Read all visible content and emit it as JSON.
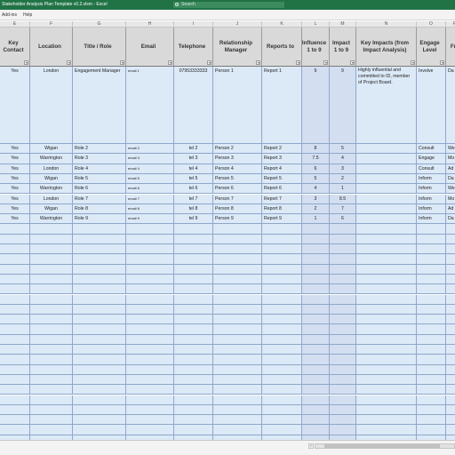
{
  "window": {
    "title": "Stakeholder Analysis Plan Template v0.2.xlsm  -  Excel",
    "search_placeholder": "Search"
  },
  "ribbon": {
    "tabs": [
      "Add-ins",
      "Help"
    ]
  },
  "columns": [
    {
      "letter": "E",
      "header": "Key\nContact",
      "key": "key_contact",
      "align": "c"
    },
    {
      "letter": "F",
      "header": "Location",
      "key": "location",
      "align": "c"
    },
    {
      "letter": "G",
      "header": "Title / Role",
      "key": "title",
      "align": "l"
    },
    {
      "letter": "H",
      "header": "Email",
      "key": "email",
      "align": "l",
      "tiny": true
    },
    {
      "letter": "I",
      "header": "Telephone",
      "key": "telephone",
      "align": "c"
    },
    {
      "letter": "J",
      "header": "Relationship\nManager",
      "key": "manager",
      "align": "l"
    },
    {
      "letter": "K",
      "header": "Reports to",
      "key": "reports_to",
      "align": "l"
    },
    {
      "letter": "L",
      "header": "Influence\n1 to 9",
      "key": "influence",
      "align": "c",
      "alt": true
    },
    {
      "letter": "M",
      "header": "Impact\n1 to 9",
      "key": "impact",
      "align": "c",
      "alt": true
    },
    {
      "letter": "N",
      "header": "Key Impacts (from\nImpact Analysis)",
      "key": "key_impacts",
      "align": "l"
    },
    {
      "letter": "O",
      "header": "Engage\nLevel",
      "key": "engage",
      "align": "l"
    },
    {
      "letter": "P",
      "header": "Fr",
      "key": "freq",
      "align": "l"
    }
  ],
  "rows": [
    {
      "key_contact": "Yes",
      "location": "London",
      "title": "Engagement Manager",
      "email": "email 1",
      "telephone": "07953333333",
      "manager": "Person 1",
      "reports_to": "Report 1",
      "influence": "9",
      "impact": "9",
      "key_impacts": "Highly influential and committed to ID, member of Project Board.",
      "engage": "Involve",
      "freq": "Da"
    },
    {
      "key_contact": "Yes",
      "location": "Wigan",
      "title": "Role 2",
      "email": "email 2",
      "telephone": "tel 2",
      "manager": "Person 2",
      "reports_to": "Report 2",
      "influence": "8",
      "impact": "5",
      "key_impacts": "",
      "engage": "Consult",
      "freq": "We"
    },
    {
      "key_contact": "Yes",
      "location": "Warrington",
      "title": "Role 3",
      "email": "email 3",
      "telephone": "tel 3",
      "manager": "Person 3",
      "reports_to": "Report 3",
      "influence": "7.5",
      "impact": "4",
      "key_impacts": "",
      "engage": "Engage",
      "freq": "Mo"
    },
    {
      "key_contact": "Yes",
      "location": "London",
      "title": "Role 4",
      "email": "email 4",
      "telephone": "tel 4",
      "manager": "Person 4",
      "reports_to": "Report 4",
      "influence": "6",
      "impact": "3",
      "key_impacts": "",
      "engage": "Consult",
      "freq": "Ad"
    },
    {
      "key_contact": "Yes",
      "location": "Wigan",
      "title": "Role 5",
      "email": "email 5",
      "telephone": "tel 5",
      "manager": "Person 5",
      "reports_to": "Report 5",
      "influence": "5",
      "impact": "2",
      "key_impacts": "",
      "engage": "Inform",
      "freq": "Da"
    },
    {
      "key_contact": "Yes",
      "location": "Warrington",
      "title": "Role 6",
      "email": "email 6",
      "telephone": "tel 6",
      "manager": "Person 6",
      "reports_to": "Report 6",
      "influence": "4",
      "impact": "1",
      "key_impacts": "",
      "engage": "Inform",
      "freq": "We"
    },
    {
      "key_contact": "Yes",
      "location": "London",
      "title": "Role 7",
      "email": "email 7",
      "telephone": "tel 7",
      "manager": "Person 7",
      "reports_to": "Report 7",
      "influence": "3",
      "impact": "8.5",
      "key_impacts": "",
      "engage": "Inform",
      "freq": "Mo"
    },
    {
      "key_contact": "Yes",
      "location": "Wigan",
      "title": "Role 8",
      "email": "email 8",
      "telephone": "tel 8",
      "manager": "Person 8",
      "reports_to": "Report 8",
      "influence": "2",
      "impact": "7",
      "key_impacts": "",
      "engage": "Inform",
      "freq": "Ad"
    },
    {
      "key_contact": "Yes",
      "location": "Warrington",
      "title": "Role 9",
      "email": "email 9",
      "telephone": "tel 9",
      "manager": "Person 9",
      "reports_to": "Report 9",
      "influence": "1",
      "impact": "6",
      "key_impacts": "",
      "engage": "Inform",
      "freq": "Da"
    }
  ],
  "empty_row_count": 24,
  "colors": {
    "title_bar": "#217346",
    "header_fill": "#d9d9d9",
    "cell_fill": "#dce9f7",
    "score_fill": "#d3dff1",
    "border": "#8fa7c9"
  },
  "icons": {
    "search": "search-icon",
    "filter": "filter-dropdown-icon"
  }
}
